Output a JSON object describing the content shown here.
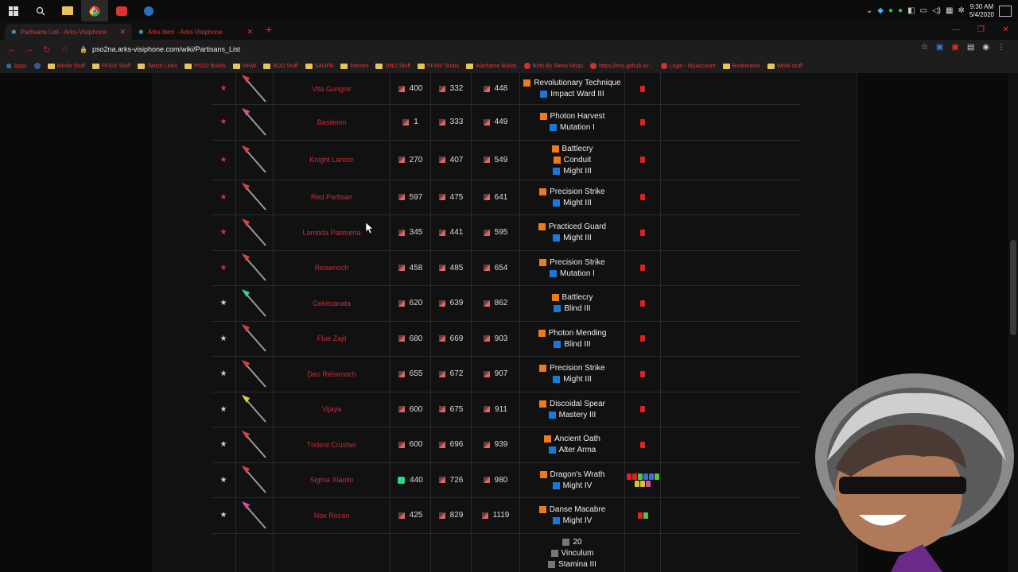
{
  "taskbar": {
    "clock_time": "9:30 AM",
    "clock_date": "5/4/2020"
  },
  "tabs": [
    {
      "label": "Partisans List - Arks-Visiphone",
      "active": true
    },
    {
      "label": "Arks Item - Arks-Visiphone",
      "active": false
    }
  ],
  "address": {
    "url": "pso2na.arks-visiphone.com/wiki/Partisans_List"
  },
  "bookmarks": [
    "Apps",
    "Media Stuff",
    "FFXIV Stuff",
    "Twitch Links",
    "PSO2 Builds",
    "MHW",
    "BDO Stuff",
    "SAOFB",
    "Memes",
    "DNO Stuff",
    "FFXIV Strats",
    "Warframe Builds",
    "Birth By Sleep Mods",
    "https://ehs.github.io/...",
    "Login - MyAccount",
    "Bookmarks",
    "WoW stuff"
  ],
  "colors": {
    "name_red": "#c82c3b",
    "affix_orange": "#f07a1a",
    "affix_blue": "#1a78d8"
  },
  "weapons": [
    {
      "rarity": "★",
      "name": "Vita Gungnir",
      "atk": "400",
      "sta": "332",
      "max": "448",
      "affixes": [
        {
          "icon": "orange",
          "text": "Revolutionary Technique"
        },
        {
          "icon": "blue",
          "text": "Impact Ward III"
        }
      ],
      "equip": [
        "red"
      ]
    },
    {
      "rarity": "★",
      "name": "Basileion",
      "atk": "1",
      "sta": "333",
      "max": "449",
      "affixes": [
        {
          "icon": "orange",
          "text": "Photon Harvest"
        },
        {
          "icon": "blue",
          "text": "Mutation I"
        }
      ],
      "equip": [
        "red"
      ]
    },
    {
      "rarity": "★",
      "name": "Knight Lancer",
      "atk": "270",
      "sta": "407",
      "max": "549",
      "affixes": [
        {
          "icon": "orange",
          "text": "Battlecry"
        },
        {
          "icon": "orange",
          "text": "Conduit"
        },
        {
          "icon": "blue",
          "text": "Might III"
        }
      ],
      "equip": [
        "red"
      ]
    },
    {
      "rarity": "★",
      "name": "Red Partisan",
      "atk": "597",
      "sta": "475",
      "max": "641",
      "affixes": [
        {
          "icon": "orange",
          "text": "Precision Strike"
        },
        {
          "icon": "blue",
          "text": "Might III"
        }
      ],
      "equip": [
        "red"
      ]
    },
    {
      "rarity": "★",
      "name": "Lambda Patimeria",
      "atk": "345",
      "sta": "441",
      "max": "595",
      "affixes": [
        {
          "icon": "orange",
          "text": "Practiced Guard"
        },
        {
          "icon": "blue",
          "text": "Might III"
        }
      ],
      "equip": [
        "red"
      ]
    },
    {
      "rarity": "★",
      "name": "Reisenoch",
      "atk": "458",
      "sta": "485",
      "max": "654",
      "affixes": [
        {
          "icon": "orange",
          "text": "Precision Strike"
        },
        {
          "icon": "blue",
          "text": "Mutation I"
        }
      ],
      "equip": [
        "red"
      ]
    },
    {
      "rarity": "★",
      "name": "Gekitsanata",
      "atk": "620",
      "sta": "639",
      "max": "862",
      "affixes": [
        {
          "icon": "orange",
          "text": "Battlecry"
        },
        {
          "icon": "blue",
          "text": "Blind III"
        }
      ],
      "equip": [
        "red"
      ]
    },
    {
      "rarity": "★",
      "name": "Flue Zajil",
      "atk": "680",
      "sta": "669",
      "max": "903",
      "affixes": [
        {
          "icon": "orange",
          "text": "Photon Mending"
        },
        {
          "icon": "blue",
          "text": "Blind III"
        }
      ],
      "equip": [
        "red"
      ]
    },
    {
      "rarity": "★",
      "name": "Deo Reisenoch",
      "atk": "655",
      "sta": "672",
      "max": "907",
      "affixes": [
        {
          "icon": "orange",
          "text": "Precision Strike"
        },
        {
          "icon": "blue",
          "text": "Might III"
        }
      ],
      "equip": [
        "red"
      ]
    },
    {
      "rarity": "★",
      "name": "Vijaya",
      "atk": "600",
      "sta": "675",
      "max": "911",
      "affixes": [
        {
          "icon": "orange",
          "text": "Discoidal Spear"
        },
        {
          "icon": "blue",
          "text": "Mastery III"
        }
      ],
      "equip": [
        "red"
      ]
    },
    {
      "rarity": "★",
      "name": "Trident Crusher",
      "atk": "600",
      "sta": "696",
      "max": "939",
      "affixes": [
        {
          "icon": "orange",
          "text": "Ancient Oath"
        },
        {
          "icon": "blue",
          "text": "Alter Arma"
        }
      ],
      "equip": [
        "red"
      ]
    },
    {
      "rarity": "★",
      "name": "Sigma Xiaolio",
      "atk": "440",
      "sta": "726",
      "max": "980",
      "affixes": [
        {
          "icon": "orange",
          "text": "Dragon's Wrath"
        },
        {
          "icon": "blue",
          "text": "Might IV"
        }
      ],
      "equip": [
        "red",
        "red",
        "green",
        "blue",
        "blue",
        "green",
        "yellow",
        "yellow",
        "pink"
      ]
    },
    {
      "rarity": "★",
      "name": "Nox Rozan",
      "atk": "425",
      "sta": "829",
      "max": "1119",
      "affixes": [
        {
          "icon": "orange",
          "text": "Danse Macabre"
        },
        {
          "icon": "blue",
          "text": "Might IV"
        }
      ],
      "equip": [
        "red",
        "green"
      ]
    },
    {
      "rarity": "",
      "name": "",
      "atk": "",
      "sta": "",
      "max": "",
      "affixes": [
        {
          "icon": "gray",
          "text": "20"
        },
        {
          "icon": "gray",
          "text": "Vinculum"
        },
        {
          "icon": "gray",
          "text": "Stamina III"
        }
      ],
      "equip": []
    }
  ]
}
